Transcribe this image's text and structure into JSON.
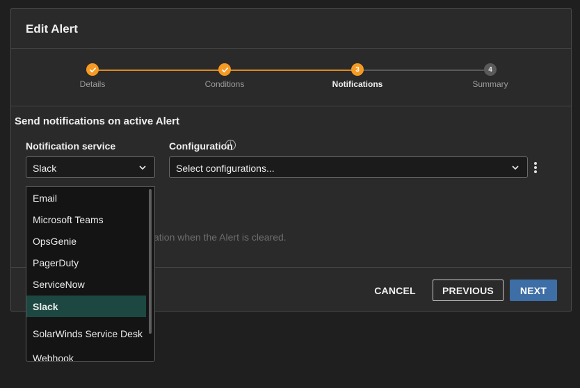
{
  "dialog": {
    "title": "Edit Alert"
  },
  "stepper": {
    "steps": [
      {
        "label": "Details",
        "state": "complete",
        "marker": ""
      },
      {
        "label": "Conditions",
        "state": "complete",
        "marker": ""
      },
      {
        "label": "Notifications",
        "state": "active",
        "marker": "3"
      },
      {
        "label": "Summary",
        "state": "pending",
        "marker": "4"
      }
    ],
    "accent_color": "#f59a23"
  },
  "section": {
    "title": "Send notifications on active Alert"
  },
  "notification_service": {
    "label": "Notification service",
    "value": "Slack",
    "icon": "chevron-down-icon"
  },
  "configuration": {
    "label": "Configuration",
    "info_icon": "info-icon",
    "placeholder": "Select configurations...",
    "icon": "chevron-down-icon",
    "menu_icon": "kebab-menu-icon"
  },
  "dropdown": {
    "options": [
      "Email",
      "Microsoft Teams",
      "OpsGenie",
      "PagerDuty",
      "ServiceNow",
      "Slack",
      "SolarWinds Service Desk",
      "Webhook"
    ],
    "selected": "Slack",
    "selected_color": "#1d4842"
  },
  "hint": {
    "partial_text": "tification when the Alert is cleared."
  },
  "footer": {
    "cancel_label": "CANCEL",
    "previous_label": "PREVIOUS",
    "next_label": "NEXT",
    "next_color": "#3d6ea5"
  }
}
